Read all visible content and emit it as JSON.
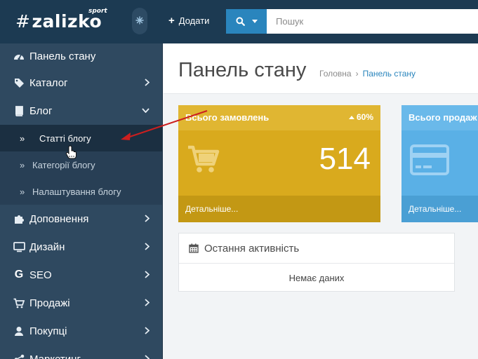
{
  "header": {
    "logo_hash": "#",
    "logo_text": "zalizko",
    "logo_sport": "sport",
    "add_label": "Додати",
    "search_placeholder": "Пошук"
  },
  "sidebar": {
    "items": [
      {
        "label": "Панель стану",
        "icon": "dashboard-icon"
      },
      {
        "label": "Каталог",
        "icon": "tag-icon"
      },
      {
        "label": "Блог",
        "icon": "book-icon"
      },
      {
        "label": "Доповнення",
        "icon": "puzzle-icon"
      },
      {
        "label": "Дизайн",
        "icon": "monitor-icon"
      },
      {
        "label": "SEO",
        "icon": "google-icon"
      },
      {
        "label": "Продажі",
        "icon": "cart-icon"
      },
      {
        "label": "Покупці",
        "icon": "user-icon"
      },
      {
        "label": "Маркетинг",
        "icon": "share-icon"
      }
    ],
    "blog_sub": [
      {
        "label": "Статті блогу"
      },
      {
        "label": "Категорії блогу"
      },
      {
        "label": "Налаштування блогу"
      }
    ]
  },
  "main": {
    "title": "Панель стану",
    "breadcrumb": {
      "home": "Головна",
      "sep": "›",
      "current": "Панель стану"
    },
    "tiles": [
      {
        "title": "Всього замовлень",
        "badge": "60%",
        "value": "514",
        "footer": "Детальніше..."
      },
      {
        "title": "Всього продаж",
        "footer": "Детальніше..."
      }
    ],
    "activity": {
      "title": "Остання активність",
      "empty": "Немає даних"
    }
  },
  "colors": {
    "header_bg": "#1c3a52",
    "sidebar_bg": "#2f4960",
    "accent": "#2a85bd",
    "tile_yellow": "#d9aa1d",
    "tile_blue": "#5ab0e6",
    "arrow": "#cc1f1f"
  }
}
